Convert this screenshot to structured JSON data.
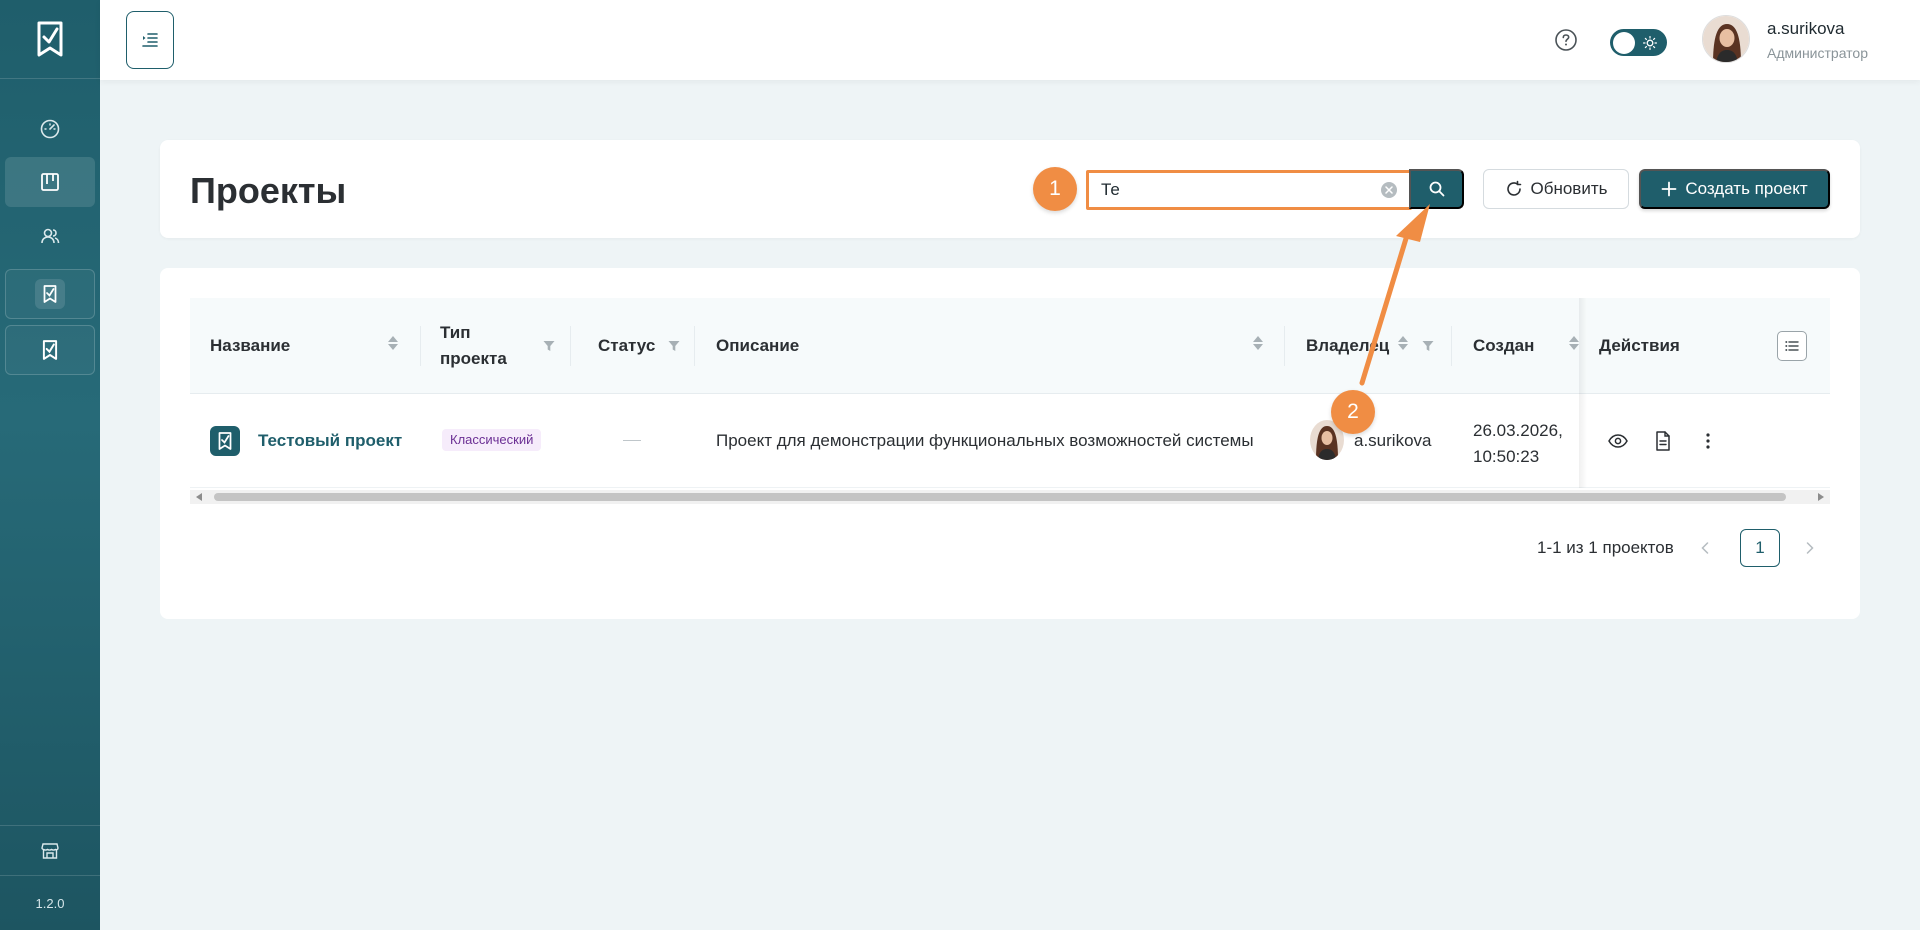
{
  "app": {
    "version": "1.2.0"
  },
  "header": {
    "user_name": "a.surikova",
    "user_role": "Администратор"
  },
  "page": {
    "title": "Проекты"
  },
  "toolbar": {
    "search_value": "Те",
    "refresh_label": "Обновить",
    "create_label": "Создать проект"
  },
  "table": {
    "columns": {
      "name": "Название",
      "type_line1": "Тип",
      "type_line2": "проекта",
      "status": "Статус",
      "description": "Описание",
      "owner": "Владелец",
      "created": "Создан",
      "actions": "Действия"
    },
    "rows": [
      {
        "name": "Тестовый проект",
        "type": "Классический",
        "status": "—",
        "description": "Проект для демонстрации функциональных возможностей системы",
        "owner": "a.surikova",
        "created_date": "26.03.2026,",
        "created_time": "10:50:23"
      }
    ]
  },
  "pagination": {
    "summary": "1-1 из 1 проектов",
    "current_page": "1"
  },
  "annotations": {
    "badge_1": "1",
    "badge_2": "2"
  },
  "colors": {
    "brand": "#1f5e6b",
    "accent": "#f08d44",
    "tag_bg": "#f6ecfb",
    "tag_text": "#6b2f94"
  }
}
